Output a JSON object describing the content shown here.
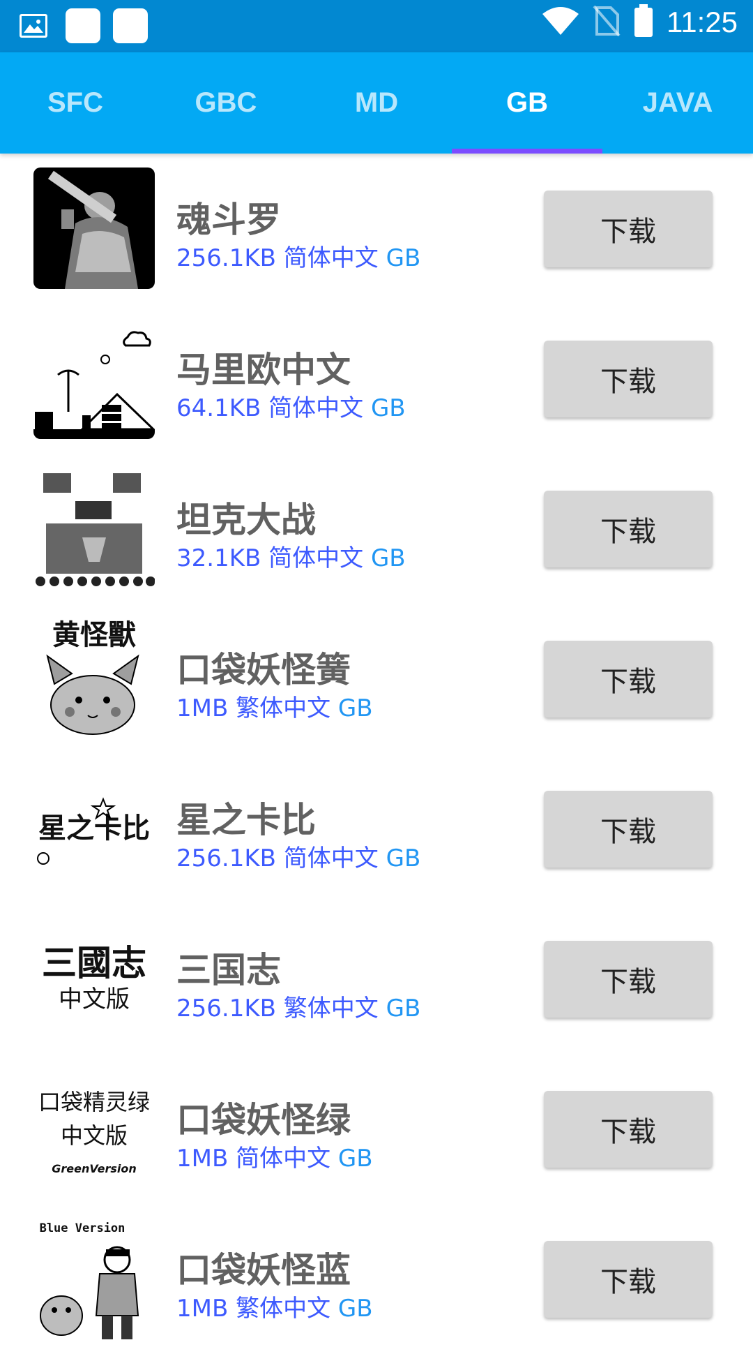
{
  "status_bar": {
    "time": "11:25",
    "left_icons": [
      "image-icon",
      "notification-icon",
      "notification-icon"
    ],
    "right_icons": [
      "wifi-icon",
      "no-sim-icon",
      "battery-icon"
    ]
  },
  "tabs": [
    {
      "label": "SFC",
      "active": false
    },
    {
      "label": "GBC",
      "active": false
    },
    {
      "label": "MD",
      "active": false
    },
    {
      "label": "GB",
      "active": true
    },
    {
      "label": "JAVA",
      "active": false
    }
  ],
  "colors": {
    "status_bar": "#0288d1",
    "tab_bar": "#03a9f4",
    "indicator": "#7c4dff",
    "meta_text": "#3d5afe",
    "title_text": "#616161",
    "button_bg": "#d6d6d6"
  },
  "games": [
    {
      "title": "魂斗罗",
      "size": "256.1KB",
      "lang": "简体中文",
      "platform": "GB",
      "button": "下载"
    },
    {
      "title": "马里欧中文",
      "size": "64.1KB",
      "lang": "简体中文",
      "platform": "GB",
      "button": "下载"
    },
    {
      "title": "坦克大战",
      "size": "32.1KB",
      "lang": "简体中文",
      "platform": "GB",
      "button": "下载"
    },
    {
      "title": "口袋妖怪簧",
      "size": "1MB",
      "lang": "繁体中文",
      "platform": "GB",
      "button": "下载",
      "thumb_text": "黄怪獸"
    },
    {
      "title": "星之卡比",
      "size": "256.1KB",
      "lang": "简体中文",
      "platform": "GB",
      "button": "下载",
      "thumb_text": "星之卡比"
    },
    {
      "title": "三国志",
      "size": "256.1KB",
      "lang": "繁体中文",
      "platform": "GB",
      "button": "下载",
      "thumb_text": "三國志",
      "thumb_sub": "中文版"
    },
    {
      "title": "口袋妖怪绿",
      "size": "1MB",
      "lang": "简体中文",
      "platform": "GB",
      "button": "下载",
      "thumb_text": "口袋精灵绿",
      "thumb_sub": "中文版",
      "thumb_sub2": "GreenVersion"
    },
    {
      "title": "口袋妖怪蓝",
      "size": "1MB",
      "lang": "繁体中文",
      "platform": "GB",
      "button": "下载",
      "thumb_text": "Blue Version"
    }
  ]
}
